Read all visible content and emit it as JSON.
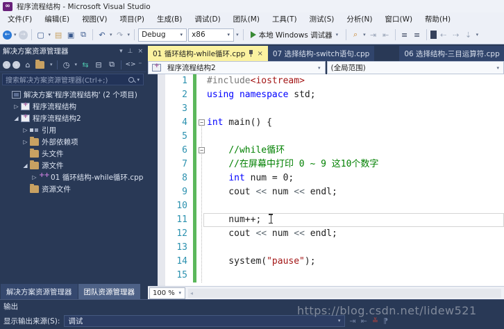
{
  "title_bar": {
    "title": "程序流程结构 - Microsoft Visual Studio"
  },
  "menu": {
    "items": [
      "文件(F)",
      "编辑(E)",
      "视图(V)",
      "项目(P)",
      "生成(B)",
      "调试(D)",
      "团队(M)",
      "工具(T)",
      "测试(S)",
      "分析(N)",
      "窗口(W)",
      "帮助(H)"
    ]
  },
  "toolbar": {
    "config_value": "Debug",
    "platform_value": "x86",
    "run_label": "本地 Windows 调试器"
  },
  "solution_explorer": {
    "title": "解决方案资源管理器",
    "search_placeholder": "搜索解决方案资源管理器(Ctrl+;)",
    "tree": [
      {
        "label": "解决方案'程序流程结构' (2 个项目)",
        "indent": 0,
        "icon": "solution",
        "arrow": "none"
      },
      {
        "label": "程序流程结构",
        "indent": 1,
        "icon": "project",
        "arrow": "collapsed"
      },
      {
        "label": "程序流程结构2",
        "indent": 1,
        "icon": "project",
        "arrow": "expanded"
      },
      {
        "label": "引用",
        "indent": 2,
        "icon": "refs",
        "arrow": "collapsed"
      },
      {
        "label": "外部依赖项",
        "indent": 2,
        "icon": "folder",
        "arrow": "collapsed"
      },
      {
        "label": "头文件",
        "indent": 2,
        "icon": "folder",
        "arrow": "none"
      },
      {
        "label": "源文件",
        "indent": 2,
        "icon": "folder",
        "arrow": "expanded"
      },
      {
        "label": "01 循环结构-while循环.cpp",
        "indent": 3,
        "icon": "cpp",
        "arrow": "collapsed"
      },
      {
        "label": "资源文件",
        "indent": 2,
        "icon": "folder",
        "arrow": "none"
      }
    ],
    "bottom_tabs": [
      {
        "label": "解决方案资源管理器",
        "active": true
      },
      {
        "label": "团队资源管理器",
        "active": false
      }
    ]
  },
  "editor": {
    "tabs": [
      {
        "label": "01 循环结构-while循环.cpp",
        "active": true
      },
      {
        "label": "07 选择结构-switch语句.cpp",
        "active": false
      },
      {
        "label": "06 选择结构-三目运算符.cpp",
        "active": false,
        "gap": true
      }
    ],
    "nav": {
      "scope": "程序流程结构2",
      "member": "(全局范围)"
    },
    "zoom_value": "100 %",
    "code_lines": [
      {
        "n": 1,
        "segs": [
          {
            "t": "#include",
            "c": "pp"
          },
          {
            "t": "<iostream>",
            "c": "str"
          }
        ]
      },
      {
        "n": 2,
        "segs": [
          {
            "t": "using",
            "c": "kw"
          },
          {
            "t": " ",
            "c": "pl"
          },
          {
            "t": "namespace",
            "c": "kw"
          },
          {
            "t": " std;",
            "c": "pl"
          }
        ]
      },
      {
        "n": 3,
        "segs": []
      },
      {
        "n": 4,
        "fold": true,
        "segs": [
          {
            "t": "int",
            "c": "kw"
          },
          {
            "t": " main() {",
            "c": "pl"
          }
        ]
      },
      {
        "n": 5,
        "segs": []
      },
      {
        "n": 6,
        "fold": true,
        "segs": [
          {
            "t": "    ",
            "c": "pl"
          },
          {
            "t": "//while循环",
            "c": "cm"
          }
        ]
      },
      {
        "n": 7,
        "segs": [
          {
            "t": "    ",
            "c": "pl"
          },
          {
            "t": "//在屏幕中打印 0 ~ 9 这10个数字",
            "c": "cm"
          }
        ]
      },
      {
        "n": 8,
        "segs": [
          {
            "t": "    ",
            "c": "pl"
          },
          {
            "t": "int",
            "c": "kw"
          },
          {
            "t": " num = 0;",
            "c": "pl"
          }
        ]
      },
      {
        "n": 9,
        "segs": [
          {
            "t": "    cout ",
            "c": "pl"
          },
          {
            "t": "<<",
            "c": "op"
          },
          {
            "t": " num ",
            "c": "pl"
          },
          {
            "t": "<<",
            "c": "op"
          },
          {
            "t": " endl;",
            "c": "pl"
          }
        ]
      },
      {
        "n": 10,
        "segs": []
      },
      {
        "n": 11,
        "current": true,
        "cursor": true,
        "segs": [
          {
            "t": "    num++; ",
            "c": "pl"
          }
        ]
      },
      {
        "n": 12,
        "segs": [
          {
            "t": "    cout ",
            "c": "pl"
          },
          {
            "t": "<<",
            "c": "op"
          },
          {
            "t": " num ",
            "c": "pl"
          },
          {
            "t": "<<",
            "c": "op"
          },
          {
            "t": " endl;",
            "c": "pl"
          }
        ]
      },
      {
        "n": 13,
        "segs": []
      },
      {
        "n": 14,
        "segs": [
          {
            "t": "    system(",
            "c": "pl"
          },
          {
            "t": "\"pause\"",
            "c": "str"
          },
          {
            "t": ");",
            "c": "pl"
          }
        ]
      },
      {
        "n": 15,
        "segs": []
      }
    ]
  },
  "output": {
    "title": "输出",
    "source_label": "显示输出来源(S):",
    "source_value": "调试"
  },
  "watermark": "https://blog.csdn.net/lidew521",
  "colors": {
    "active_tab": "#FBF2A0",
    "keyword": "#0000FF",
    "comment": "#008000",
    "string": "#A31515",
    "line_number": "#2B91AF",
    "change_bar": "#5BB75B",
    "vs_purple": "#68217A",
    "run_green": "#388934",
    "panel_bg": "#293956"
  }
}
